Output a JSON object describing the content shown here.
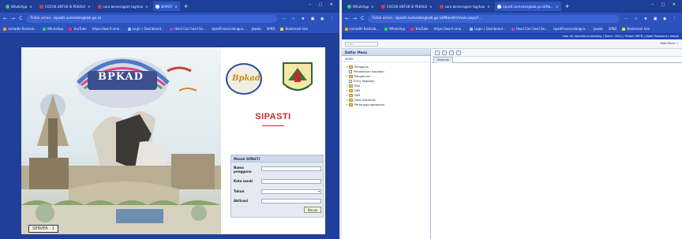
{
  "left_window": {
    "tabs": [
      {
        "label": "WhatsApp",
        "color": "#25d366"
      },
      {
        "label": "COCOK UNTUK SI PEKALO",
        "color": "#e53935"
      },
      {
        "label": "cara berseragam tagihan",
        "color": "#e53935"
      },
      {
        "label": "SIPASTI",
        "color": "#ffffff"
      }
    ],
    "new_tab": "+",
    "window_controls": "– ▢ ✕",
    "nav": {
      "back": "←",
      "forward": "→",
      "reload": "C"
    },
    "url": {
      "secure_label": "Tidak aman",
      "text": "sipasti.sumedangkab.go.id"
    },
    "extensions": "⋯ ☆ ★ ▣ ◉ ⋮",
    "bookmarks": [
      "romadhi Rostrab...",
      "WhatsApp",
      "YouTube",
      "https://ww.fr.amk...",
      "Login | Dashboard...",
      "Hasil Cari hasil Se...",
      "sipkdFinancialangca...",
      "Jawab",
      "SPKD",
      "Bookmark lain"
    ],
    "page": {
      "hero_title": "BPKAD",
      "server_label": "SERVER - 1",
      "logo_text": "Bpkad",
      "app_title": "SIPASTI",
      "form": {
        "header": "Masuk SIPASTI",
        "fields": [
          {
            "label": "Nama pengguna",
            "value": ""
          },
          {
            "label": "Kata sandi",
            "value": ""
          },
          {
            "label": "Tahun",
            "value": ""
          },
          {
            "label": "Aktivasi",
            "value": ""
          }
        ],
        "submit_label": "Masuk"
      }
    }
  },
  "right_window": {
    "tabs": [
      {
        "label": "WhatsApp",
        "color": "#25d366"
      },
      {
        "label": "COCOK UNTUK SI PEKALO",
        "color": "#e53935"
      },
      {
        "label": "cara berseragam tagihan",
        "color": "#e53935"
      },
      {
        "label": "sipasti.sumedangkab.go.id/Ma...",
        "color": "#ffffff"
      }
    ],
    "new_tab": "+",
    "window_controls": "– ▢ ✕",
    "url": {
      "secure_label": "Tidak aman",
      "text": "sipasti.sumedangkab.go.id/Mandiri/main.aspx?..."
    },
    "bookmarks": [
      "romadhi Rostrab...",
      "WhatsApp",
      "YouTube",
      "https://ww.fr.amk...",
      "Login | Dashboard...",
      "Hasil Cari hasil Se...",
      "sipkdFinancialangca...",
      "Jawab",
      "SPKD",
      "Bookmark lain"
    ],
    "app": {
      "header_text": "User ID: kominfo.sumedang | Tahun: 2022 | Pindah SKPD | Ubah Password | Keluar",
      "search_placeholder": "Cari...",
      "hide_menu": "Hide Menu ‹‹",
      "sidebar_title": "Daftar Menu",
      "sidebar_sub": "SIPKD",
      "tree": [
        {
          "label": "Pengguna",
          "type": "folder"
        },
        {
          "label": "Pendaftaran Kegiatan",
          "type": "leaf"
        },
        {
          "label": "Pengaturan",
          "type": "folder"
        },
        {
          "label": "Entry Kegiatan",
          "type": "leaf"
        },
        {
          "label": "RKA",
          "type": "folder"
        },
        {
          "label": "DPA",
          "type": "folder"
        },
        {
          "label": "DAS",
          "type": "folder"
        },
        {
          "label": "Data Distribusi",
          "type": "folder"
        },
        {
          "label": "Pertanggungjawaban",
          "type": "folder"
        }
      ],
      "content_tab": "Beranda"
    }
  }
}
